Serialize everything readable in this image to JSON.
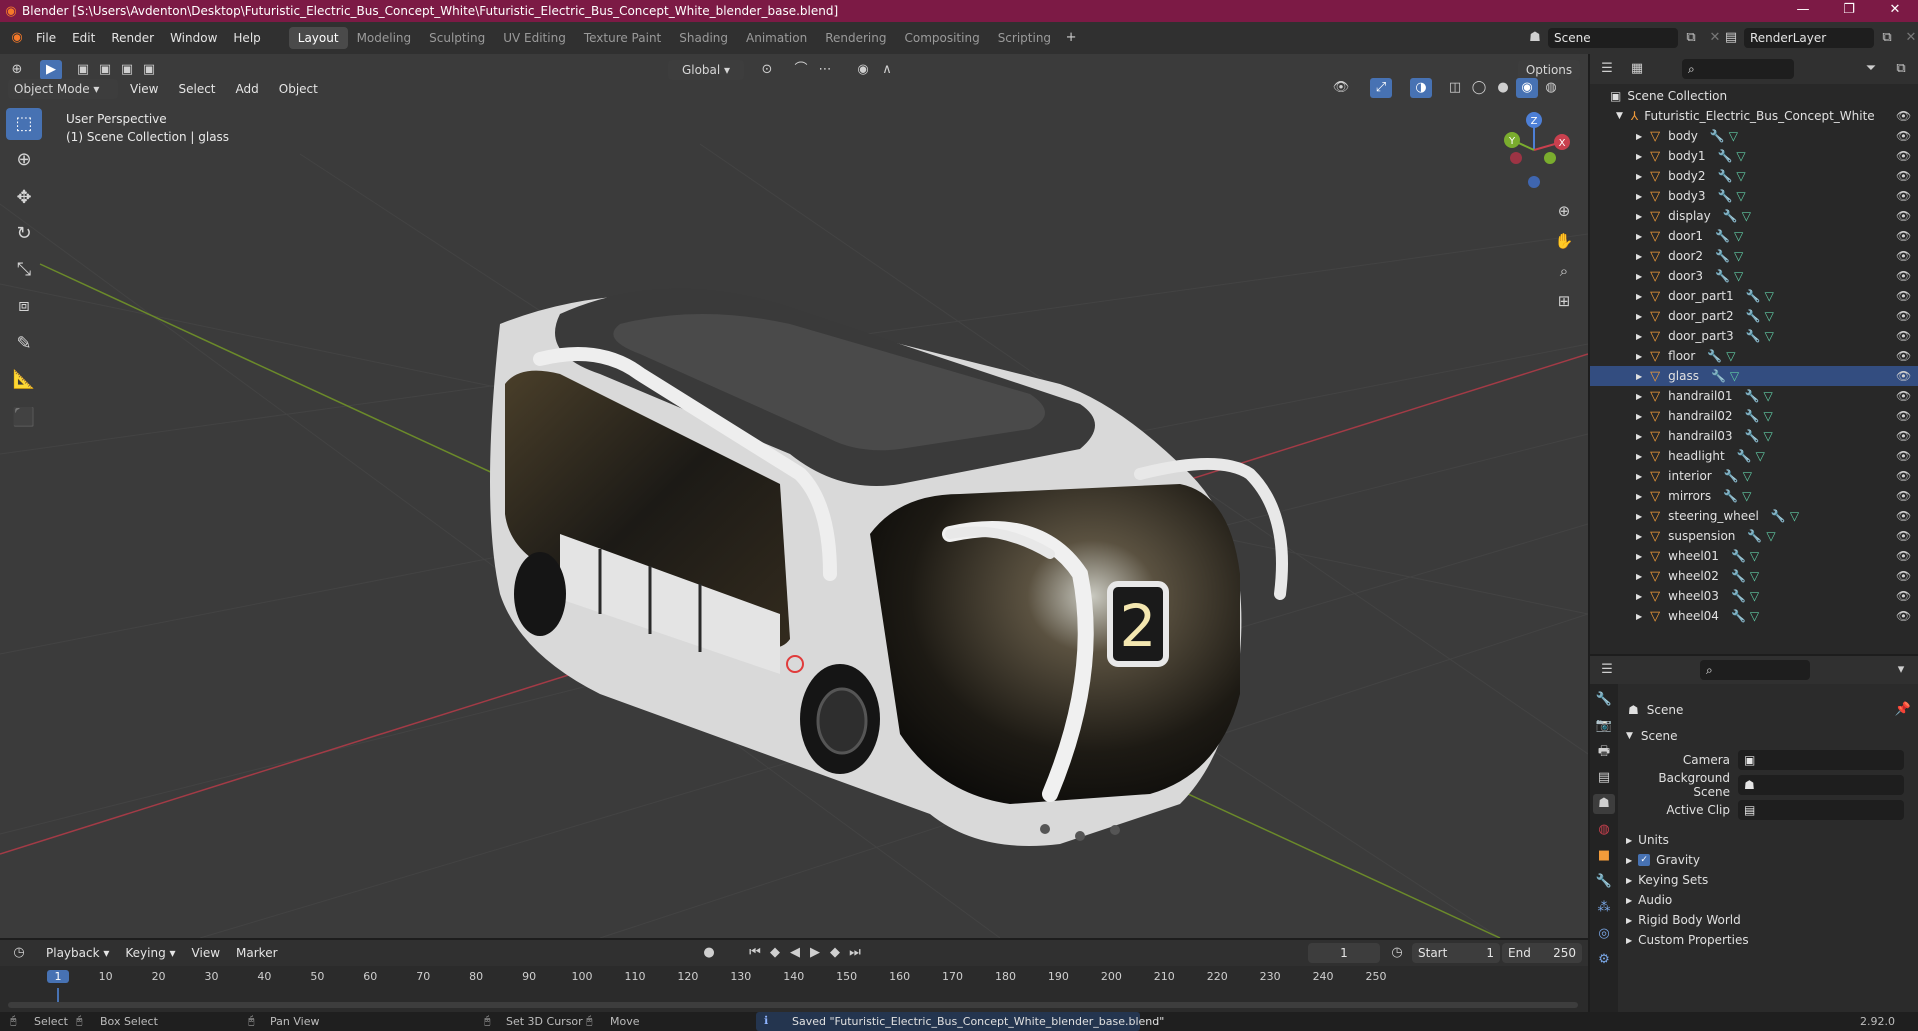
{
  "titlebar": {
    "app_title": "Blender [S:\\Users\\Avdenton\\Desktop\\Futuristic_Electric_Bus_Concept_White\\Futuristic_Electric_Bus_Concept_White_blender_base.blend]",
    "minimize": "—",
    "maximize": "❐",
    "close": "✕"
  },
  "menu": [
    "File",
    "Edit",
    "Render",
    "Window",
    "Help"
  ],
  "workspaces": [
    "Layout",
    "Modeling",
    "Sculpting",
    "UV Editing",
    "Texture Paint",
    "Shading",
    "Animation",
    "Rendering",
    "Compositing",
    "Scripting"
  ],
  "active_workspace": "Layout",
  "scene_field": "Scene",
  "renderlayer_field": "RenderLayer",
  "viewport": {
    "mode": "Object Mode",
    "menus": [
      "View",
      "Select",
      "Add",
      "Object"
    ],
    "transform_orientation": "Global",
    "options": "Options",
    "overlay_line1": "User Perspective",
    "overlay_line2": "(1) Scene Collection | glass",
    "bus_number": "2",
    "gizmo_z": "Z",
    "gizmo_y": "Y",
    "gizmo_x": "X"
  },
  "outliner": {
    "root": "Scene Collection",
    "collection": "Futuristic_Electric_Bus_Concept_White",
    "objects": [
      "body",
      "body1",
      "body2",
      "body3",
      "display",
      "door1",
      "door2",
      "door3",
      "door_part1",
      "door_part2",
      "door_part3",
      "floor",
      "glass",
      "handrail01",
      "handrail02",
      "handrail03",
      "headlight",
      "interior",
      "mirrors",
      "steering_wheel",
      "suspension",
      "wheel01",
      "wheel02",
      "wheel03",
      "wheel04"
    ],
    "selected": "glass"
  },
  "properties": {
    "header": "Scene",
    "panel": "Scene",
    "camera_label": "Camera",
    "background_scene_label": "Background Scene",
    "active_clip_label": "Active Clip",
    "sections": [
      "Units",
      "Gravity",
      "Keying Sets",
      "Audio",
      "Rigid Body World",
      "Custom Properties"
    ],
    "gravity_checked": true
  },
  "timeline": {
    "menus": [
      "Playback",
      "Keying",
      "View",
      "Marker"
    ],
    "current_frame": "1",
    "start_label": "Start",
    "start": "1",
    "end_label": "End",
    "end": "250",
    "ticks": [
      "1",
      "10",
      "20",
      "30",
      "40",
      "50",
      "60",
      "70",
      "80",
      "90",
      "100",
      "110",
      "120",
      "130",
      "140",
      "150",
      "160",
      "170",
      "180",
      "190",
      "200",
      "210",
      "220",
      "230",
      "240",
      "250"
    ]
  },
  "status": {
    "select": "Select",
    "box_select": "Box Select",
    "pan_view": "Pan View",
    "set_cursor": "Set 3D Cursor",
    "move": "Move",
    "message": "Saved \"Futuristic_Electric_Bus_Concept_White_blender_base.blend\"",
    "version": "2.92.0"
  },
  "colors": {
    "titlebar": "#7c1a45",
    "accent": "#4772b3",
    "object_icon": "#f29b3a",
    "mesh_icon": "#60c9a3",
    "modifier_icon": "#7aa7e6"
  }
}
